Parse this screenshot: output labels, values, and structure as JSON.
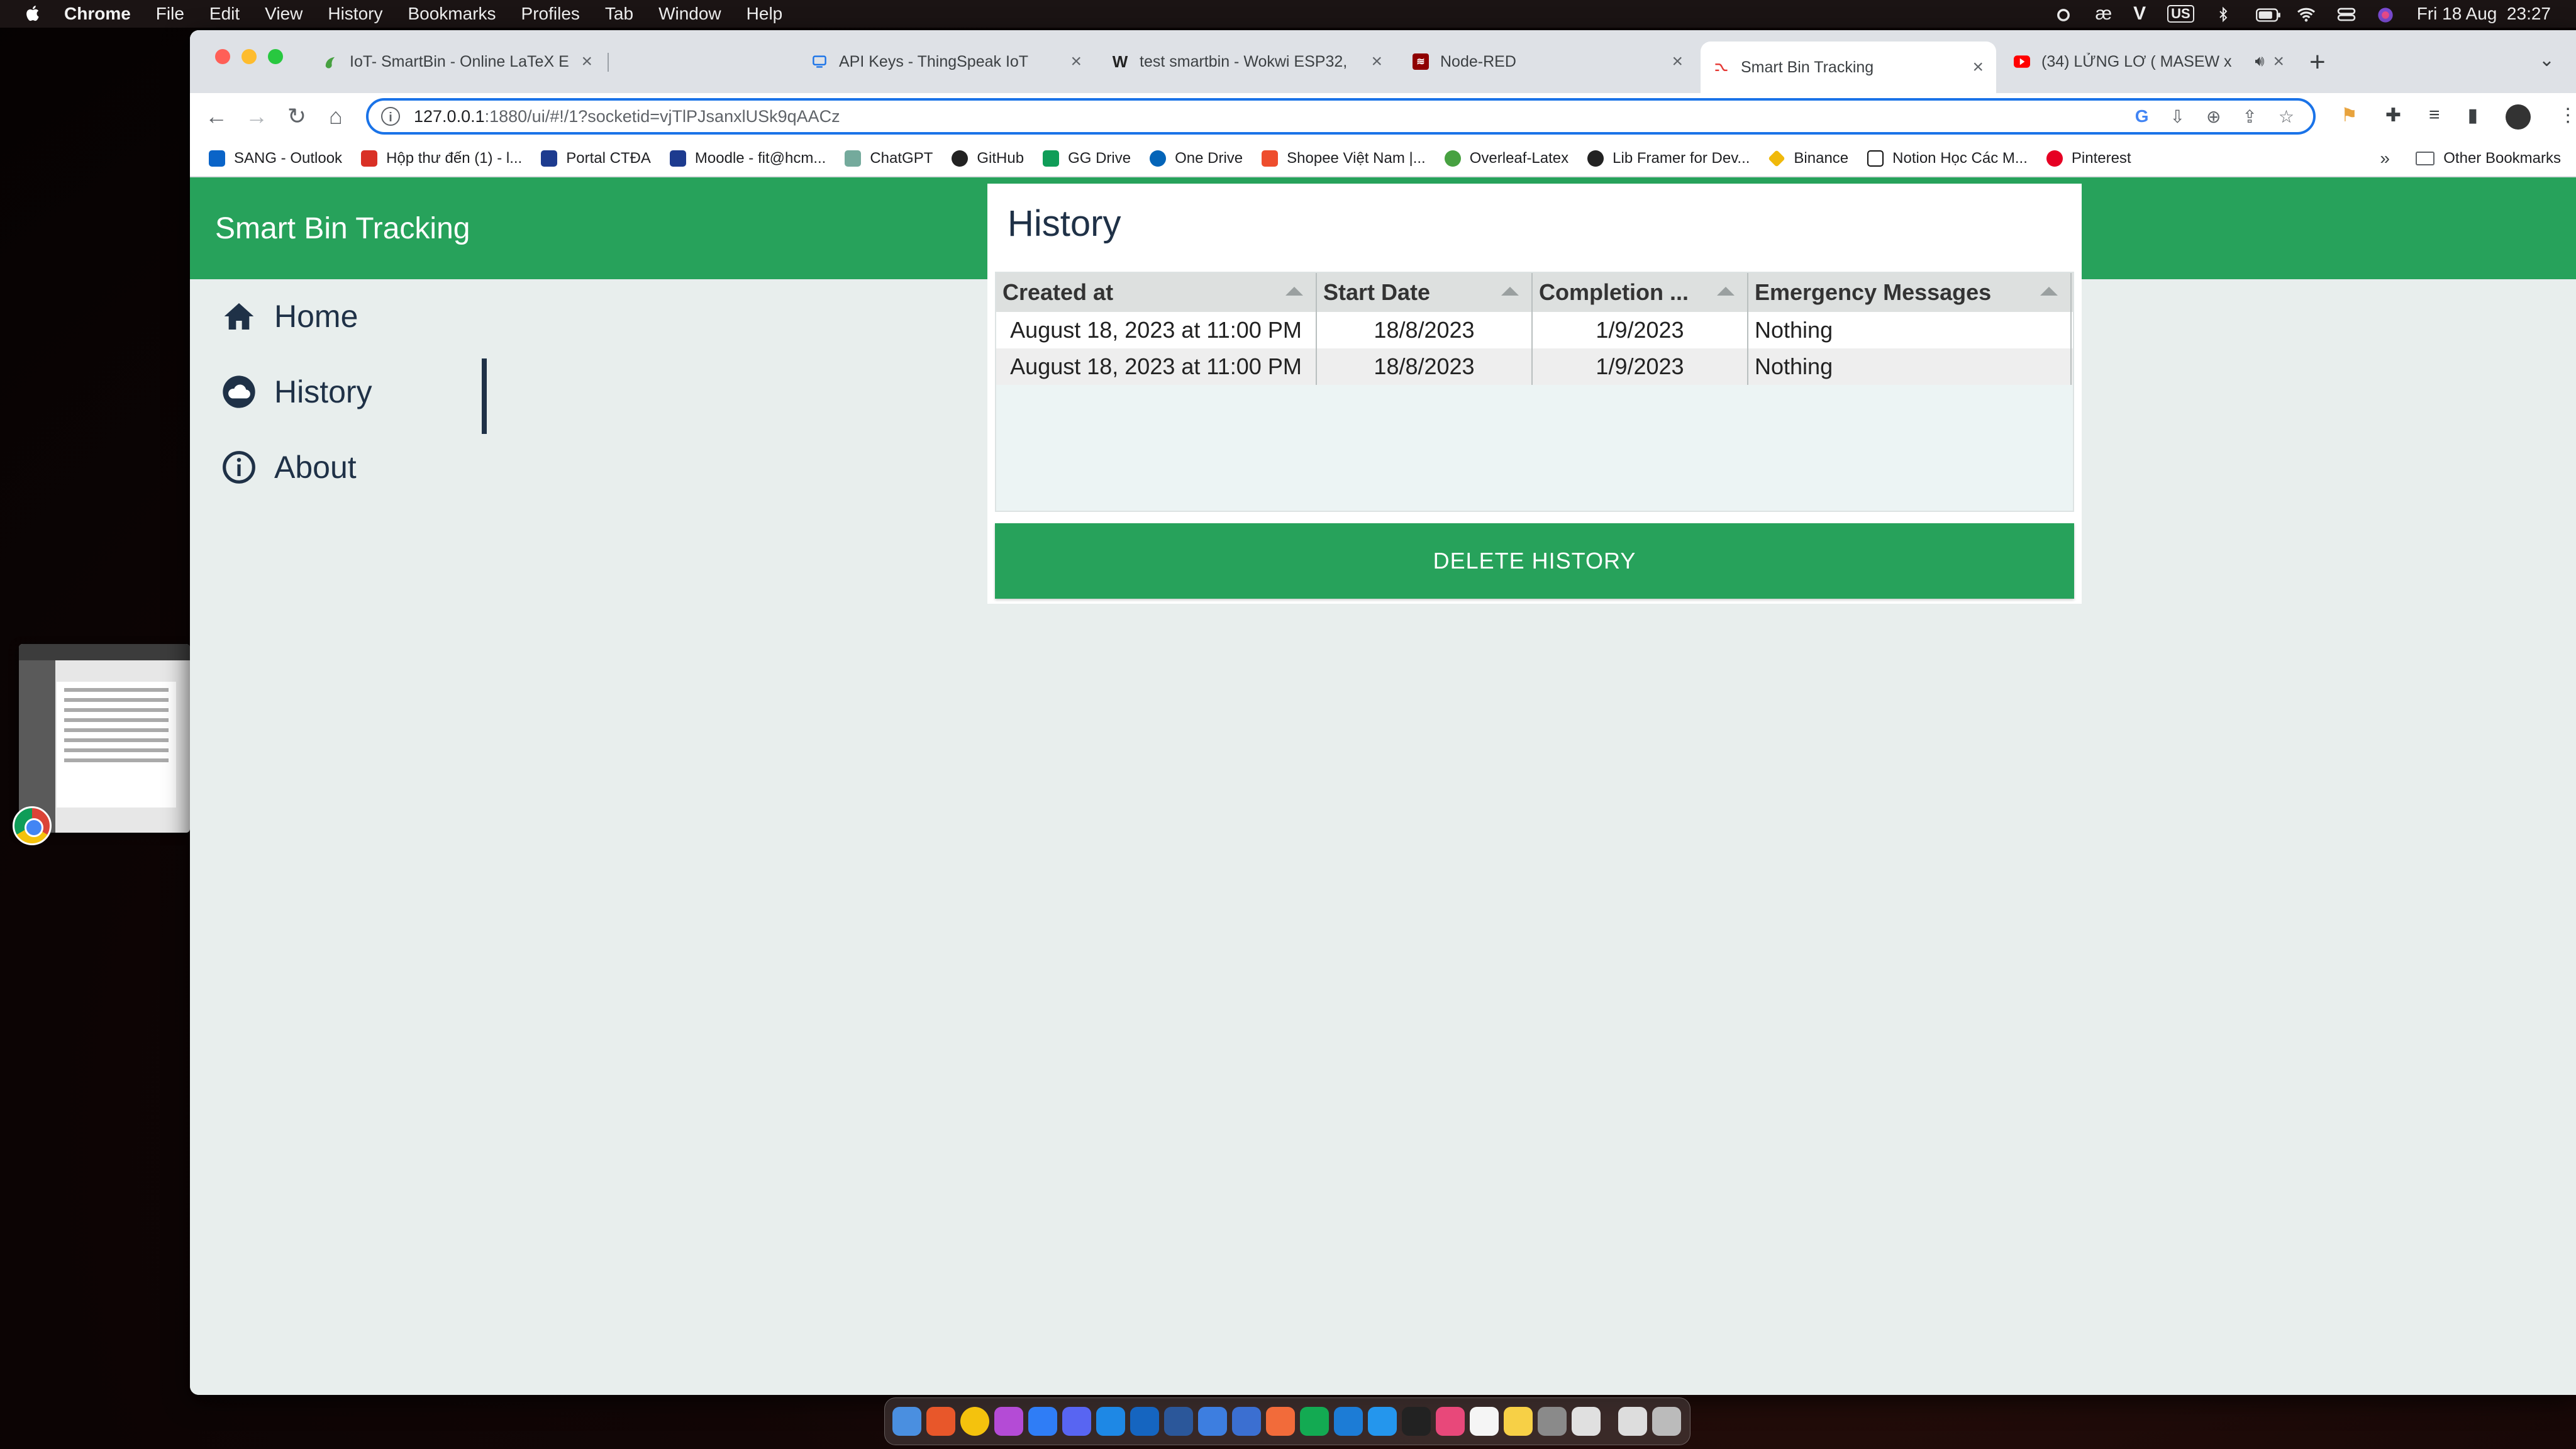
{
  "menubar": {
    "app": "Chrome",
    "items": [
      "File",
      "Edit",
      "View",
      "History",
      "Bookmarks",
      "Profiles",
      "Tab",
      "Window",
      "Help"
    ],
    "input_source": "US",
    "datetime": "Fri 18 Aug  23:27"
  },
  "browser": {
    "tabs": [
      {
        "label": "IoT- SmartBin - Online LaTeX E",
        "icon": "overleaf-icon",
        "color": "#47a141"
      },
      {
        "label": "API Keys - ThingSpeak IoT",
        "icon": "thingspeak-icon",
        "color": "#1a73e8"
      },
      {
        "label": "test smartbin - Wokwi ESP32,",
        "icon": "wokwi-icon",
        "color": "#222222"
      },
      {
        "label": "Node-RED",
        "icon": "nodered-icon",
        "color": "#8f0000"
      },
      {
        "label": "Smart Bin Tracking",
        "icon": "nodered-dashboard-icon",
        "color": "#e53935"
      },
      {
        "label": "(34) LỬNG LƠ ( MASEW x",
        "icon": "youtube-icon",
        "color": "#ff0000"
      }
    ],
    "url_host": "127.0.0.1",
    "url_rest": ":1880/ui/#!/1?socketid=vjTlPJsanxlUSk9qAACz",
    "bookmarks": [
      {
        "label": "SANG - Outlook",
        "color": "#0a64c8"
      },
      {
        "label": "Hộp thư đến (1) - l...",
        "color": "#d93025"
      },
      {
        "label": "Portal CTĐA",
        "color": "#1d3b8f"
      },
      {
        "label": "Moodle - fit@hcm...",
        "color": "#1d3b8f"
      },
      {
        "label": "ChatGPT",
        "color": "#74aa9c"
      },
      {
        "label": "GitHub",
        "color": "#222222"
      },
      {
        "label": "GG Drive",
        "color": "#0f9d58"
      },
      {
        "label": "One Drive",
        "color": "#0364b8"
      },
      {
        "label": "Shopee Việt Nam |...",
        "color": "#ee4d2d"
      },
      {
        "label": "Overleaf-Latex",
        "color": "#47a141"
      },
      {
        "label": "Lib Framer for Dev...",
        "color": "#222222"
      },
      {
        "label": "Binance",
        "color": "#f0b90b"
      },
      {
        "label": "Notion Học Các M...",
        "color": "#111111"
      },
      {
        "label": "Pinterest",
        "color": "#e60023"
      }
    ],
    "more_bookmarks": "»",
    "other_bookmarks": "Other Bookmarks"
  },
  "app": {
    "title": "Smart Bin Tracking",
    "accent": "#27a25b",
    "nav": [
      {
        "label": "Home",
        "icon": "home-icon"
      },
      {
        "label": "History",
        "icon": "cloud-icon",
        "active": true
      },
      {
        "label": "About",
        "icon": "info-icon"
      }
    ],
    "history": {
      "title": "History",
      "columns": [
        "Created at",
        "Start Date",
        "Completion ...",
        "Emergency Messages"
      ],
      "rows": [
        [
          "August 18, 2023 at 11:00 PM",
          "18/8/2023",
          "1/9/2023",
          "Nothing"
        ],
        [
          "August 18, 2023 at 11:00 PM",
          "18/8/2023",
          "1/9/2023",
          "Nothing"
        ]
      ],
      "delete_label": "DELETE HISTORY"
    }
  }
}
